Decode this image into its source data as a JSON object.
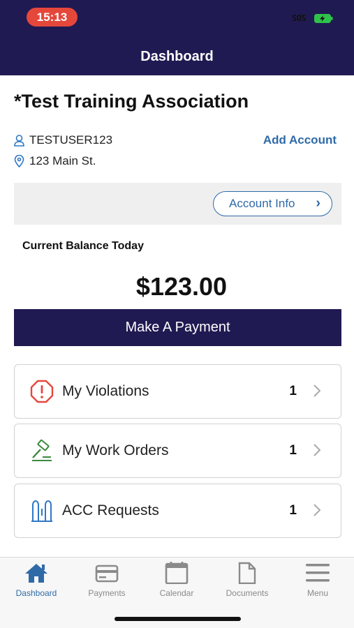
{
  "status": {
    "time": "15:13",
    "carrier": "SOS"
  },
  "header": {
    "title": "Dashboard"
  },
  "association": {
    "name": "*Test Training Association"
  },
  "account": {
    "username": "TESTUSER123",
    "address": "123 Main St.",
    "add_account_label": "Add Account",
    "info_button_label": "Account Info"
  },
  "balance": {
    "label": "Current Balance Today",
    "amount": "$123.00"
  },
  "payment": {
    "button_label": "Make A Payment"
  },
  "cards": [
    {
      "label": "My Violations",
      "count": "1",
      "icon": "stop-alert-icon"
    },
    {
      "label": "My Work Orders",
      "count": "1",
      "icon": "hammer-icon"
    },
    {
      "label": "ACC Requests",
      "count": "1",
      "icon": "door-icon"
    }
  ],
  "tabs": [
    {
      "label": "Dashboard",
      "icon": "home-icon",
      "active": true
    },
    {
      "label": "Payments",
      "icon": "credit-card-icon",
      "active": false
    },
    {
      "label": "Calendar",
      "icon": "calendar-icon",
      "active": false
    },
    {
      "label": "Documents",
      "icon": "document-icon",
      "active": false
    },
    {
      "label": "Menu",
      "icon": "hamburger-menu-icon",
      "active": false
    }
  ],
  "colors": {
    "navy": "#201a52",
    "link_blue": "#2f6aa8",
    "alert_red": "#e5473b",
    "work_green": "#3b8a3e",
    "acc_blue": "#2f78c4",
    "tab_inactive": "#8a8a8a"
  }
}
